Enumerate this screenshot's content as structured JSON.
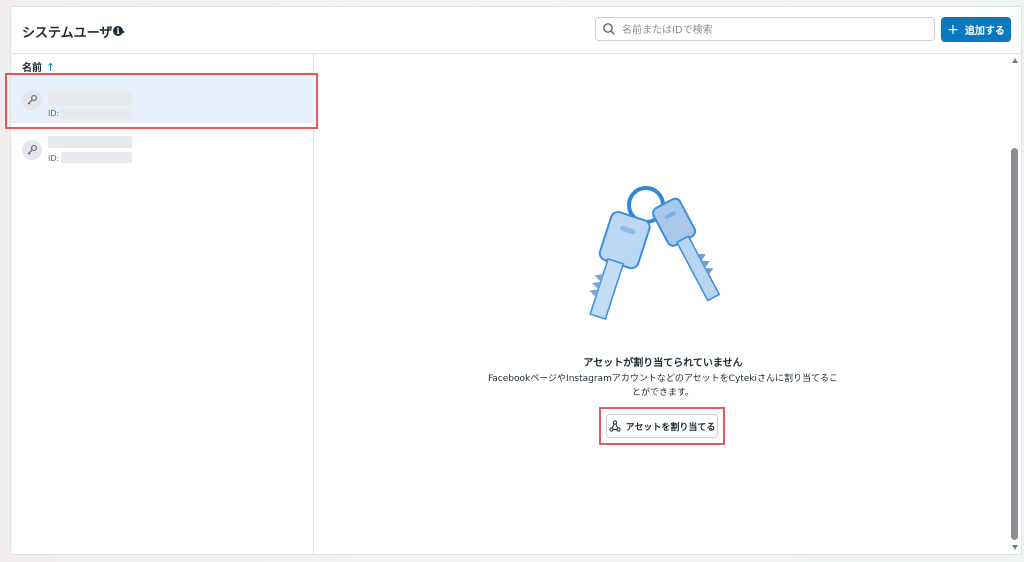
{
  "header": {
    "title": "システムユーザー",
    "search_placeholder": "名前またはIDで検索",
    "add_label": "追加する"
  },
  "sidebar": {
    "column_header": "名前",
    "items": [
      {
        "id_label": "ID:",
        "selected": true
      },
      {
        "id_label": "ID:",
        "selected": false
      }
    ]
  },
  "empty_state": {
    "title": "アセットが割り当てられていません",
    "description": "FacebookページやInstagramアカウントなどのアセットをCytekiさんに割り当てることができます。",
    "assign_label": "アセットを割り当てる"
  },
  "colors": {
    "accent": "#0a78be",
    "highlight": "#e05a5a",
    "selected_row": "#e7f0fb"
  }
}
